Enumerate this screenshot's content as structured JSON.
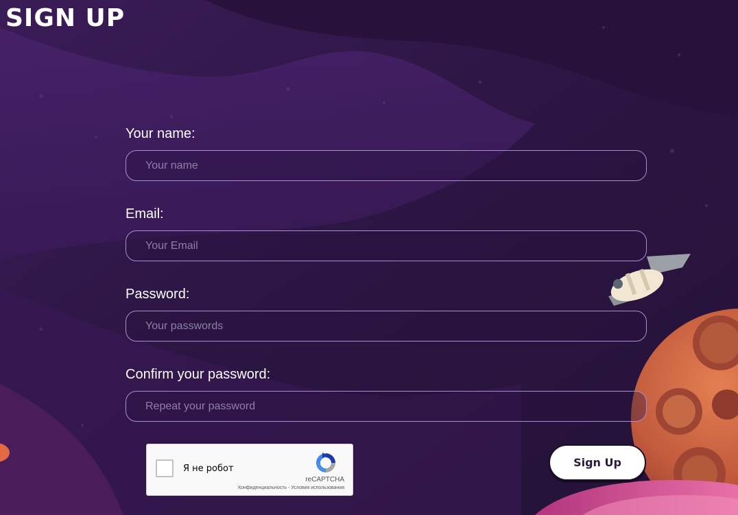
{
  "page": {
    "title": "SIGN UP"
  },
  "form": {
    "fields": [
      {
        "label": "Your name:",
        "placeholder": "Your name",
        "value": ""
      },
      {
        "label": "Email:",
        "placeholder": "Your Email",
        "value": ""
      },
      {
        "label": "Password:",
        "placeholder": "Your passwords",
        "value": ""
      },
      {
        "label": "Confirm your password:",
        "placeholder": "Repeat your password",
        "value": ""
      }
    ],
    "submit_label": "Sign Up"
  },
  "captcha": {
    "checkbox_label": "Я не робот",
    "brand": "reCAPTCHA",
    "links": "Конфиденциальность - Условия использования"
  },
  "colors": {
    "background": "#2a1540",
    "input_border": "#a88fd4",
    "text": "#ffffff"
  },
  "icons": [
    "recaptcha-logo-icon",
    "spaceship-illustration",
    "planet-illustration"
  ]
}
